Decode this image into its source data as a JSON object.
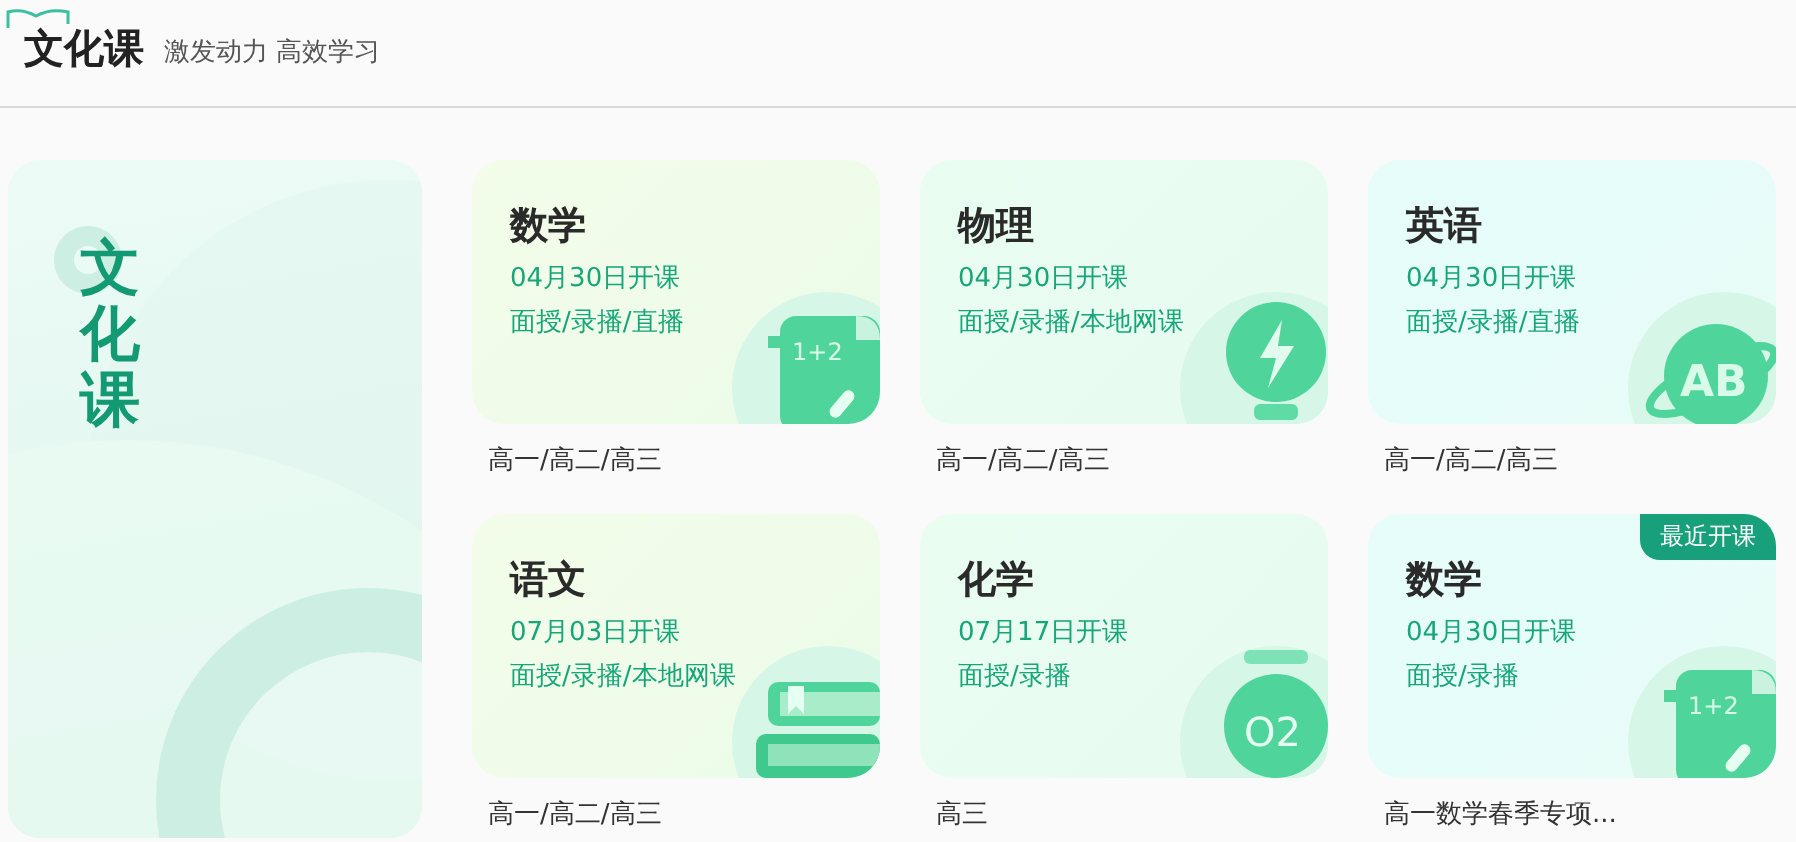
{
  "header": {
    "title": "文化课",
    "subtitle": "激发动力 高效学习"
  },
  "side_panel": {
    "title": "文化课"
  },
  "courses": [
    {
      "name": "数学",
      "start": "04月30日开课",
      "modes": "面授/录播/直播",
      "grades": "高一/高二/高三",
      "kind": "math",
      "icon_label": "1+2"
    },
    {
      "name": "物理",
      "start": "04月30日开课",
      "modes": "面授/录播/本地网课",
      "grades": "高一/高二/高三",
      "kind": "physics"
    },
    {
      "name": "英语",
      "start": "04月30日开课",
      "modes": "面授/录播/直播",
      "grades": "高一/高二/高三",
      "kind": "english",
      "icon_label": "AB"
    },
    {
      "name": "语文",
      "start": "07月03日开课",
      "modes": "面授/录播/本地网课",
      "grades": "高一/高二/高三",
      "kind": "chinese"
    },
    {
      "name": "化学",
      "start": "07月17日开课",
      "modes": "面授/录播",
      "grades": "高三",
      "kind": "chemistry",
      "icon_label": "O2"
    },
    {
      "name": "数学",
      "start": "04月30日开课",
      "modes": "面授/录播",
      "grades": "高一数学春季专项...",
      "kind": "math",
      "icon_label": "1+2",
      "badge": "最近开课"
    }
  ]
}
